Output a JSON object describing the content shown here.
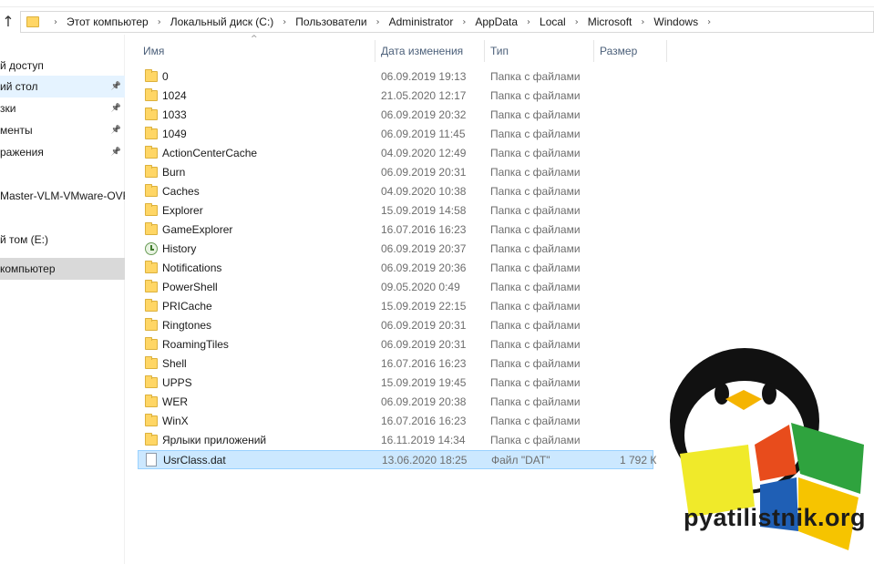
{
  "address_bar": {
    "crumbs": [
      "Этот компьютер",
      "Локальный диск (C:)",
      "Пользователи",
      "Administrator",
      "AppData",
      "Local",
      "Microsoft",
      "Windows"
    ]
  },
  "nav": {
    "items": [
      {
        "label": "й доступ",
        "pinned": false
      },
      {
        "label": "ий стол",
        "pinned": true
      },
      {
        "label": "зки",
        "pinned": true
      },
      {
        "label": "менты",
        "pinned": true
      },
      {
        "label": "ражения",
        "pinned": true
      },
      {
        "label": "Master-VLM-VMware-OVF",
        "pinned": false
      },
      {
        "label": "й том (E:)",
        "pinned": false
      },
      {
        "label": "компьютер",
        "pinned": false
      }
    ]
  },
  "columns": {
    "name": "Имя",
    "date": "Дата изменения",
    "type": "Тип",
    "size": "Размер"
  },
  "files": [
    {
      "name": "0",
      "date": "06.09.2019 19:13",
      "type": "Папка с файлами",
      "size": "",
      "icon": "folder-icon"
    },
    {
      "name": "1024",
      "date": "21.05.2020 12:17",
      "type": "Папка с файлами",
      "size": "",
      "icon": "folder-icon"
    },
    {
      "name": "1033",
      "date": "06.09.2019 20:32",
      "type": "Папка с файлами",
      "size": "",
      "icon": "folder-icon"
    },
    {
      "name": "1049",
      "date": "06.09.2019 11:45",
      "type": "Папка с файлами",
      "size": "",
      "icon": "folder-icon"
    },
    {
      "name": "ActionCenterCache",
      "date": "04.09.2020 12:49",
      "type": "Папка с файлами",
      "size": "",
      "icon": "folder-icon"
    },
    {
      "name": "Burn",
      "date": "06.09.2019 20:31",
      "type": "Папка с файлами",
      "size": "",
      "icon": "folder-icon"
    },
    {
      "name": "Caches",
      "date": "04.09.2020 10:38",
      "type": "Папка с файлами",
      "size": "",
      "icon": "folder-icon"
    },
    {
      "name": "Explorer",
      "date": "15.09.2019 14:58",
      "type": "Папка с файлами",
      "size": "",
      "icon": "folder-icon"
    },
    {
      "name": "GameExplorer",
      "date": "16.07.2016 16:23",
      "type": "Папка с файлами",
      "size": "",
      "icon": "folder-icon"
    },
    {
      "name": "History",
      "date": "06.09.2019 20:37",
      "type": "Папка с файлами",
      "size": "",
      "icon": "history-icon"
    },
    {
      "name": "Notifications",
      "date": "06.09.2019 20:36",
      "type": "Папка с файлами",
      "size": "",
      "icon": "folder-icon"
    },
    {
      "name": "PowerShell",
      "date": "09.05.2020 0:49",
      "type": "Папка с файлами",
      "size": "",
      "icon": "folder-icon"
    },
    {
      "name": "PRICache",
      "date": "15.09.2019 22:15",
      "type": "Папка с файлами",
      "size": "",
      "icon": "folder-icon"
    },
    {
      "name": "Ringtones",
      "date": "06.09.2019 20:31",
      "type": "Папка с файлами",
      "size": "",
      "icon": "folder-icon"
    },
    {
      "name": "RoamingTiles",
      "date": "06.09.2019 20:31",
      "type": "Папка с файлами",
      "size": "",
      "icon": "folder-icon"
    },
    {
      "name": "Shell",
      "date": "16.07.2016 16:23",
      "type": "Папка с файлами",
      "size": "",
      "icon": "folder-icon"
    },
    {
      "name": "UPPS",
      "date": "15.09.2019 19:45",
      "type": "Папка с файлами",
      "size": "",
      "icon": "folder-icon"
    },
    {
      "name": "WER",
      "date": "06.09.2019 20:38",
      "type": "Папка с файлами",
      "size": "",
      "icon": "folder-icon"
    },
    {
      "name": "WinX",
      "date": "16.07.2016 16:23",
      "type": "Папка с файлами",
      "size": "",
      "icon": "folder-icon"
    },
    {
      "name": "Ярлыки приложений",
      "date": "16.11.2019 14:34",
      "type": "Папка с файлами",
      "size": "",
      "icon": "folder-icon"
    },
    {
      "name": "UsrClass.dat",
      "date": "13.06.2020 18:25",
      "type": "Файл \"DAT\"",
      "size": "1 792 К",
      "icon": "file-icon",
      "selected": true
    }
  ],
  "watermark": {
    "text": "pyatilistnik.org"
  },
  "colors": {
    "selection_bg": "#cce8ff",
    "hover_bg": "#e5f3ff",
    "folder_yellow": "#ffd665",
    "header_text": "#4c607a"
  }
}
